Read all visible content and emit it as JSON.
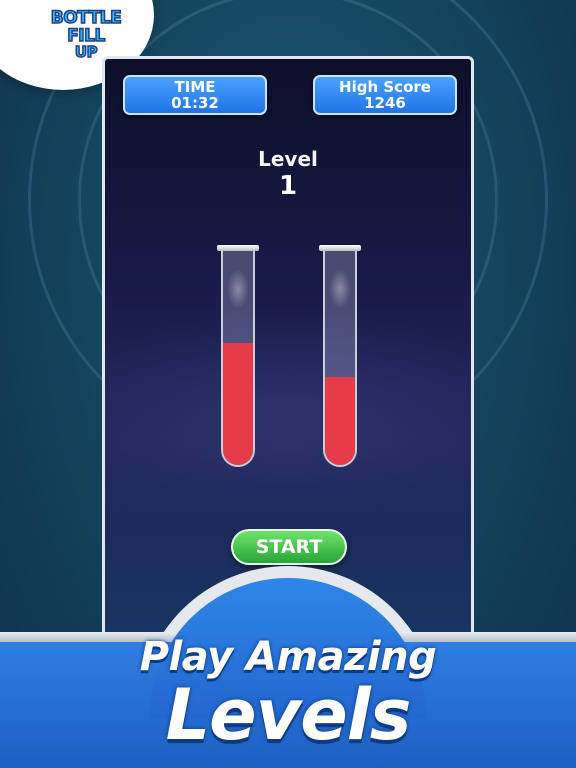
{
  "logo": {
    "lines": [
      "BOTTLE",
      "FILL",
      "UP"
    ]
  },
  "hud": {
    "time_label": "TIME",
    "time_value": "01:32",
    "score_label": "High Score",
    "score_value": "1246"
  },
  "level": {
    "label": "Level",
    "number": "1"
  },
  "tubes": [
    {
      "fill_fraction": 0.57,
      "liquid_color": "#e63c4a"
    },
    {
      "fill_fraction": 0.41,
      "liquid_color": "#e63c4a"
    }
  ],
  "start_button": {
    "label": "START"
  },
  "promo": {
    "line1": "Play Amazing",
    "line2": "Levels"
  },
  "colors": {
    "hud_blue": "#2f86f0",
    "start_green": "#3cc34a",
    "liquid_red": "#e63c4a",
    "banner_blue": "#2570d8"
  }
}
